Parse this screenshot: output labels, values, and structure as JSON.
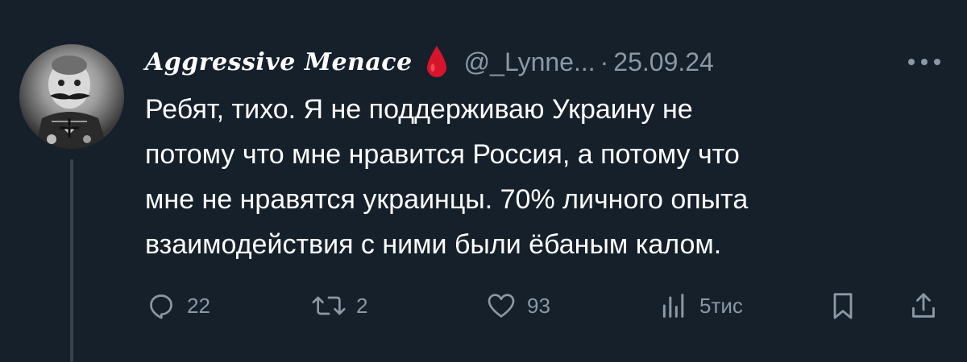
{
  "tweet": {
    "display_name": "Aggressive Menace",
    "handle": "@_Lynne...",
    "separator": "·",
    "date": "25.09.24",
    "text": "Ребят, тихо. Я не поддерживаю Украину не\nпотому что мне нравится Россия, а потому что\nмне не нравятся украинцы. 70% личного опыта\nвзаимодействия с ними были ёбаным калом."
  },
  "actions": {
    "replies": "22",
    "reposts": "2",
    "likes": "93",
    "views": "5тис"
  },
  "icons": {
    "name_badge": "blood-drop-icon",
    "more": "more-dots-icon",
    "reply": "reply-bubble-icon",
    "repost": "repost-icon",
    "like": "heart-icon",
    "views": "views-chart-icon",
    "bookmark": "bookmark-icon",
    "share": "share-icon"
  },
  "colors": {
    "background": "#15202b",
    "text_primary": "#ffffff",
    "text_secondary": "#8b98a5",
    "drop": "#d8142b"
  }
}
